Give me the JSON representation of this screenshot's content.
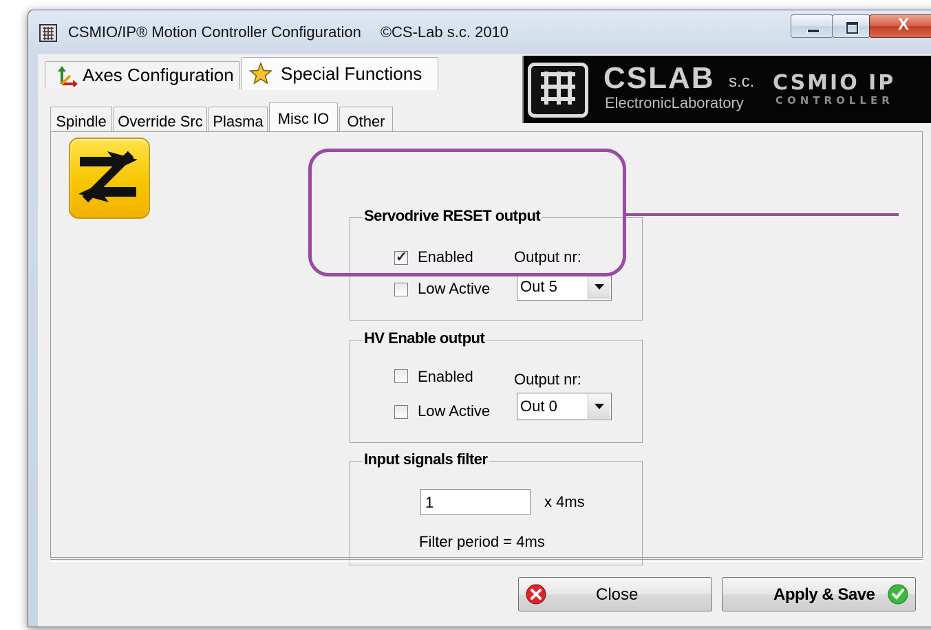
{
  "window": {
    "title": "CSMIO/IP® Motion Controller Configuration",
    "copyright": "©CS-Lab s.c. 2010",
    "min_glyph": "—",
    "close_glyph": "X"
  },
  "top_tabs": [
    {
      "label": "Axes Configuration",
      "icon": "axes-icon"
    },
    {
      "label": "Special Functions",
      "icon": "star-icon",
      "active": true
    }
  ],
  "banner": {
    "brand": "CSLAB",
    "brand_suffix": "s.c.",
    "tagline": "ElectronicLaboratory",
    "product": "CSMIO IP",
    "product_sub": "CONTROLLER"
  },
  "sub_tabs": [
    {
      "label": "Spindle"
    },
    {
      "label": "Override Src"
    },
    {
      "label": "Plasma"
    },
    {
      "label": "Misc IO",
      "active": true
    },
    {
      "label": "Other"
    }
  ],
  "servo_reset": {
    "title": "Servodrive RESET output",
    "enabled_label": "Enabled",
    "enabled": true,
    "low_active_label": "Low Active",
    "low_active": false,
    "output_label": "Output nr:",
    "output_value": "Out 5"
  },
  "hv_enable": {
    "title": "HV Enable output",
    "enabled_label": "Enabled",
    "enabled": false,
    "low_active_label": "Low Active",
    "low_active": false,
    "output_label": "Output nr:",
    "output_value": "Out 0"
  },
  "input_filter": {
    "title": "Input signals filter",
    "value": "1",
    "unit": "x 4ms",
    "period_text": "Filter period = 4ms"
  },
  "buttons": {
    "close": "Close",
    "apply": "Apply & Save"
  },
  "colors": {
    "highlight": "#9a4ba3",
    "close_icon": "#d9262b",
    "apply_icon": "#3cb93c"
  }
}
